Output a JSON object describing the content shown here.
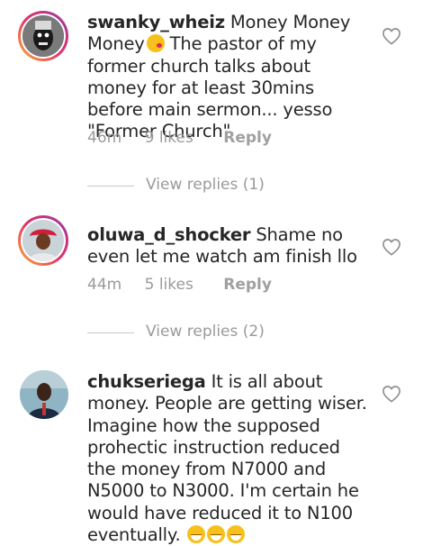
{
  "comments": [
    {
      "username": "swanky_wheiz",
      "text": "Money Money Money",
      "text_after": "The pastor of my former church talks about money for at least 30mins before main sermon... yesso \"Former Church\"",
      "emoji": "kissing-face-emoji",
      "time": "46m",
      "likes": "9 likes",
      "reply_label": "Reply",
      "view_replies": "View replies (1)"
    },
    {
      "username": "oluwa_d_shocker",
      "text": "Shame no even let me watch am finish llo",
      "time": "44m",
      "likes": "5 likes",
      "reply_label": "Reply",
      "view_replies": "View replies (2)"
    },
    {
      "username": "chukseriega",
      "text": "It is all about money. People are getting wiser. Imagine how the supposed prohectic instruction reduced the money from N7000 and N5000 to N3000. I'm certain he would have reduced it to N100 eventually.",
      "emoji": "laughing-face-emoji"
    }
  ],
  "colors": {
    "text": "#262626",
    "muted": "#9a9a9a",
    "heart_stroke": "#8e8e8e"
  }
}
